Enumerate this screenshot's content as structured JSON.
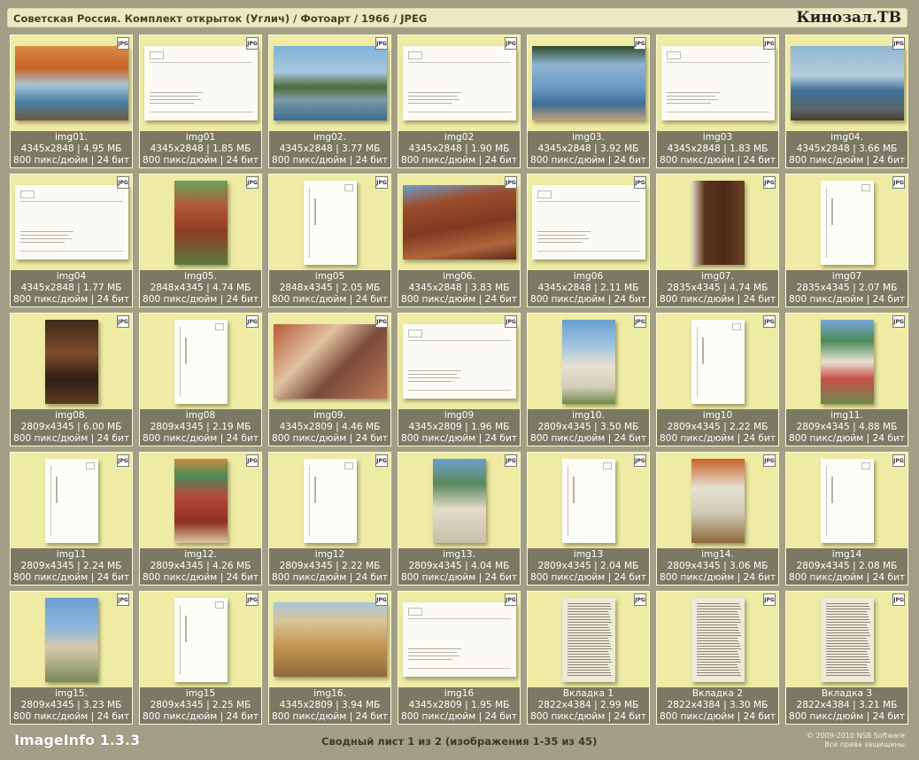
{
  "header": {
    "title": "Советская Россия. Комплект открыток (Углич) / Фотоарт / 1966 / JPEG",
    "brand": "Кинозал.ТВ"
  },
  "jpg_icon_label": "JPG",
  "thumb_colors": {
    "autumn": "#c8622a",
    "river": "#4c7fa6",
    "brick": "#8f3b24",
    "church_white": "#e7e1d2",
    "sky": "#6b9fd0",
    "dark_wood": "#4a2a16"
  },
  "cards": [
    {
      "name": "img01.",
      "dims": "4345x2848 | 4.95 МБ",
      "meta": "800 пикс/дюйм | 24 бит",
      "kind": "photo-land",
      "scene": "autumn-river"
    },
    {
      "name": "img01",
      "dims": "4345x2848 | 1.85 МБ",
      "meta": "800 пикс/дюйм | 24 бит",
      "kind": "text-land"
    },
    {
      "name": "img02.",
      "dims": "4345x2848 | 3.77 МБ",
      "meta": "800 пикс/дюйм | 24 бит",
      "kind": "photo-land",
      "scene": "church-river"
    },
    {
      "name": "img02",
      "dims": "4345x2848 | 1.90 МБ",
      "meta": "800 пикс/дюйм | 24 бит",
      "kind": "text-land"
    },
    {
      "name": "img03.",
      "dims": "4345x2848 | 3.92 МБ",
      "meta": "800 пикс/дюйм | 24 бит",
      "kind": "photo-land",
      "scene": "lake-trees"
    },
    {
      "name": "img03",
      "dims": "4345x2848 | 1.83 МБ",
      "meta": "800 пикс/дюйм | 24 бит",
      "kind": "text-land"
    },
    {
      "name": "img04.",
      "dims": "4345x2848 | 3.66 МБ",
      "meta": "800 пикс/дюйм | 24 бит",
      "kind": "photo-land",
      "scene": "embankment"
    },
    {
      "name": "img04",
      "dims": "4345x2848 | 1.77 МБ",
      "meta": "800 пикс/дюйм | 24 бит",
      "kind": "text-land"
    },
    {
      "name": "img05.",
      "dims": "2848x4345 | 4.74 МБ",
      "meta": "800 пикс/дюйм | 24 бит",
      "kind": "photo-port",
      "scene": "brick-house"
    },
    {
      "name": "img05",
      "dims": "2848x4345 | 2.05 МБ",
      "meta": "800 пикс/дюйм | 24 бит",
      "kind": "text-port"
    },
    {
      "name": "img06.",
      "dims": "4345x2848 | 3.83 МБ",
      "meta": "800 пикс/дюйм | 24 бит",
      "kind": "photo-land",
      "scene": "brick-wall"
    },
    {
      "name": "img06",
      "dims": "4345x2848 | 2.11 МБ",
      "meta": "800 пикс/дюйм | 24 бит",
      "kind": "text-land"
    },
    {
      "name": "img07.",
      "dims": "2835x4345 | 4.74 МБ",
      "meta": "800 пикс/дюйм | 24 бит",
      "kind": "photo-port",
      "scene": "wood-door"
    },
    {
      "name": "img07",
      "dims": "2835x4345 | 2.07 МБ",
      "meta": "800 пикс/дюйм | 24 бит",
      "kind": "text-port"
    },
    {
      "name": "img08.",
      "dims": "2809x4345 | 6.00 МБ",
      "meta": "800 пикс/дюйм | 24 бит",
      "kind": "photo-port",
      "scene": "bell-interior"
    },
    {
      "name": "img08",
      "dims": "2809x4345 | 2.19 МБ",
      "meta": "800 пикс/дюйм | 24 бит",
      "kind": "text-port"
    },
    {
      "name": "img09.",
      "dims": "4345x2809 | 4.46 МБ",
      "meta": "800 пикс/дюйм | 24 бит",
      "kind": "photo-land",
      "scene": "fresco"
    },
    {
      "name": "img09",
      "dims": "4345x2809 | 1.96 МБ",
      "meta": "800 пикс/дюйм | 24 бит",
      "kind": "text-land"
    },
    {
      "name": "img10.",
      "dims": "2809x4345 | 3.50 МБ",
      "meta": "800 пикс/дюйм | 24 бит",
      "kind": "photo-port",
      "scene": "white-church"
    },
    {
      "name": "img10",
      "dims": "2809x4345 | 2.22 МБ",
      "meta": "800 пикс/дюйм | 24 бит",
      "kind": "text-port"
    },
    {
      "name": "img11.",
      "dims": "2809x4345 | 4.88 МБ",
      "meta": "800 пикс/дюйм | 24 бит",
      "kind": "photo-port",
      "scene": "green-domes"
    },
    {
      "name": "img11",
      "dims": "2809x4345 | 2.24 МБ",
      "meta": "800 пикс/дюйм | 24 бит",
      "kind": "text-port"
    },
    {
      "name": "img12.",
      "dims": "2809x4345 | 4.26 МБ",
      "meta": "800 пикс/дюйм | 24 бит",
      "kind": "photo-port",
      "scene": "red-church"
    },
    {
      "name": "img12",
      "dims": "2809x4345 | 2.22 МБ",
      "meta": "800 пикс/дюйм | 24 бит",
      "kind": "text-port"
    },
    {
      "name": "img13.",
      "dims": "2809x4345 | 4.04 МБ",
      "meta": "800 пикс/дюйм | 24 бит",
      "kind": "photo-port",
      "scene": "green-domes-sky"
    },
    {
      "name": "img13",
      "dims": "2809x4345 | 2.04 МБ",
      "meta": "800 пикс/дюйм | 24 бит",
      "kind": "text-port"
    },
    {
      "name": "img14.",
      "dims": "2809x4345 | 3.06 МБ",
      "meta": "800 пикс/дюйм | 24 бит",
      "kind": "photo-port",
      "scene": "church-autumn"
    },
    {
      "name": "img14",
      "dims": "2809x4345 | 2.08 МБ",
      "meta": "800 пикс/дюйм | 24 бит",
      "kind": "text-port"
    },
    {
      "name": "img15.",
      "dims": "2809x4345 | 3.23 МБ",
      "meta": "800 пикс/дюйм | 24 бит",
      "kind": "photo-port",
      "scene": "bell-tower"
    },
    {
      "name": "img15",
      "dims": "2809x4345 | 2.25 МБ",
      "meta": "800 пикс/дюйм | 24 бит",
      "kind": "text-port"
    },
    {
      "name": "img16.",
      "dims": "4345x2809 | 3.94 МБ",
      "meta": "800 пикс/дюйм | 24 бит",
      "kind": "photo-land",
      "scene": "carved-facade"
    },
    {
      "name": "img16",
      "dims": "4345x2809 | 1.95 МБ",
      "meta": "800 пикс/дюйм | 24 бит",
      "kind": "text-land"
    },
    {
      "name": "Вкладка 1",
      "dims": "2822x4384 | 2.99 МБ",
      "meta": "800 пикс/дюйм | 24 бит",
      "kind": "page-port"
    },
    {
      "name": "Вкладка 2",
      "dims": "2822x4384 | 3.30 МБ",
      "meta": "800 пикс/дюйм | 24 бит",
      "kind": "page-port"
    },
    {
      "name": "Вкладка 3",
      "dims": "2822x4384 | 3.21 МБ",
      "meta": "800 пикс/дюйм | 24 бит",
      "kind": "page-port"
    }
  ],
  "footer": {
    "app": "ImageInfo 1.3.3",
    "sheet": "Сводный лист 1 из 2 (изображения 1-35 из 45)",
    "copyright": "© 2009-2010 NSB Software",
    "rights": "Все права защищены"
  }
}
